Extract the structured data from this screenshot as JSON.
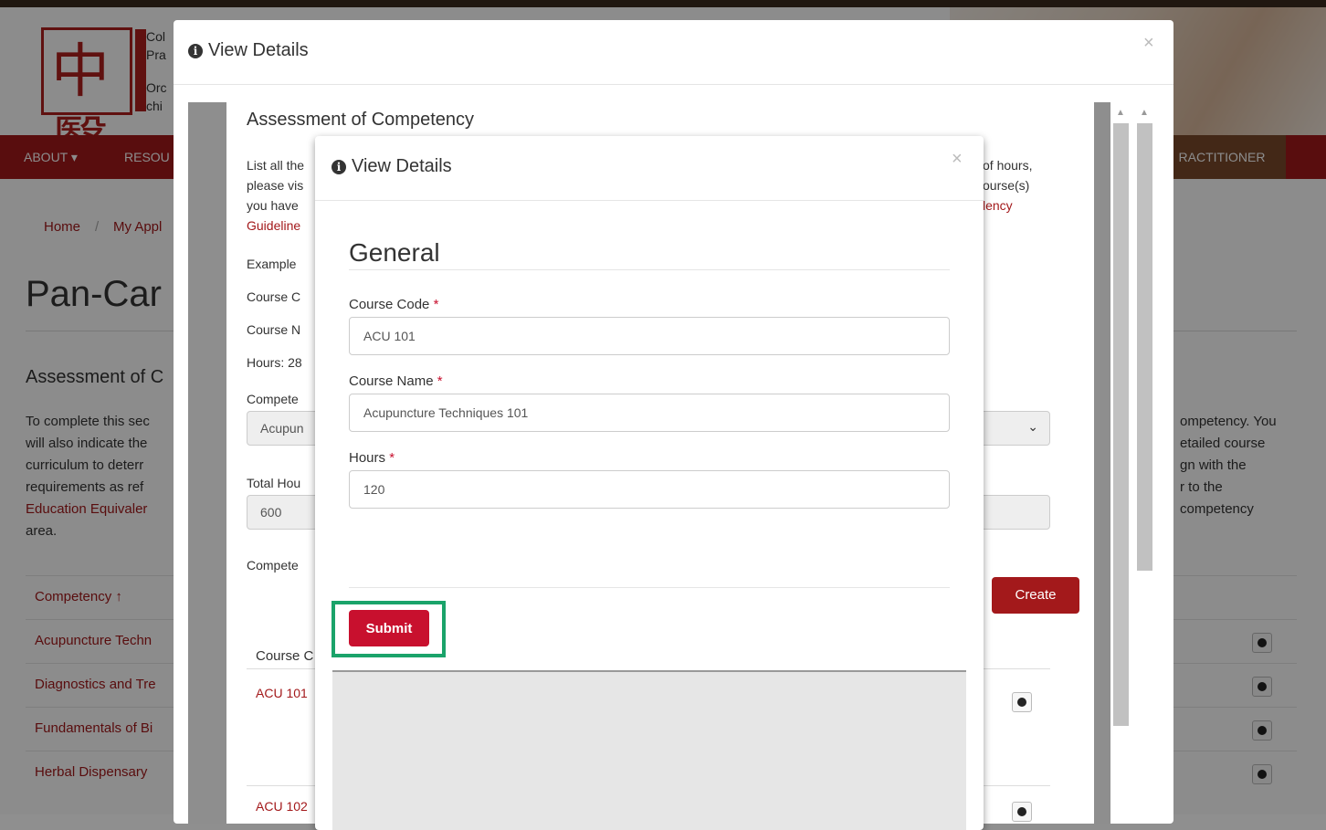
{
  "site": {
    "logo_lines": [
      "Col",
      "Pra",
      "Orc",
      "chi"
    ],
    "logo_glyph": "中醫",
    "nav": {
      "about": "ABOUT ▾",
      "resources": "RESOU",
      "practitioner": "RACTITIONER"
    },
    "breadcrumb": {
      "home": "Home",
      "sep": "/",
      "current": "My Appl"
    },
    "page_title": "Pan-Car",
    "section_title": "Assessment of C",
    "intro_left": [
      "To complete this sec",
      "will also indicate the",
      "curriculum to deterr",
      "requirements as ref",
      "Education Equivaler",
      "area."
    ],
    "intro_right": [
      "ompetency. You",
      "etailed course",
      "gn with the",
      "r to the",
      "competency"
    ],
    "competency_header": "Competency ↑",
    "competency_rows": [
      "Acupuncture Techn",
      "Diagnostics and Tre",
      "Fundamentals of Bi",
      "Herbal Dispensary"
    ]
  },
  "modal_outer": {
    "title": "View Details",
    "close": "×",
    "frame": {
      "title": "Assessment of Competency",
      "intro_left": [
        "List all the",
        "please vis",
        "you have",
        "Guideline"
      ],
      "intro_right": [
        "of hours,",
        "ourse(s)",
        "lency"
      ],
      "example": "Example",
      "course_code_lbl": "Course C",
      "course_name_lbl": "Course N",
      "hours_lbl": "Hours: 28",
      "competency_lbl": "Compete",
      "competency_value": "Acupun",
      "total_hours_lbl": "Total Hou",
      "total_hours_value": "600",
      "competencies_lbl": "Compete",
      "create_label": "Create",
      "table_header": "Course C",
      "rows": [
        "ACU 101",
        "ACU 102"
      ]
    }
  },
  "modal_inner": {
    "title": "View Details",
    "close": "×",
    "section": "General",
    "fields": {
      "course_code": {
        "label": "Course Code",
        "value": "ACU 101"
      },
      "course_name": {
        "label": "Course Name",
        "value": "Acupuncture Techniques 101"
      },
      "hours": {
        "label": "Hours",
        "value": "120"
      }
    },
    "required_mark": "*",
    "submit_label": "Submit"
  },
  "colors": {
    "brand_red": "#a3191b",
    "submit_red": "#c8102e",
    "highlight_green": "#1aa36a"
  }
}
